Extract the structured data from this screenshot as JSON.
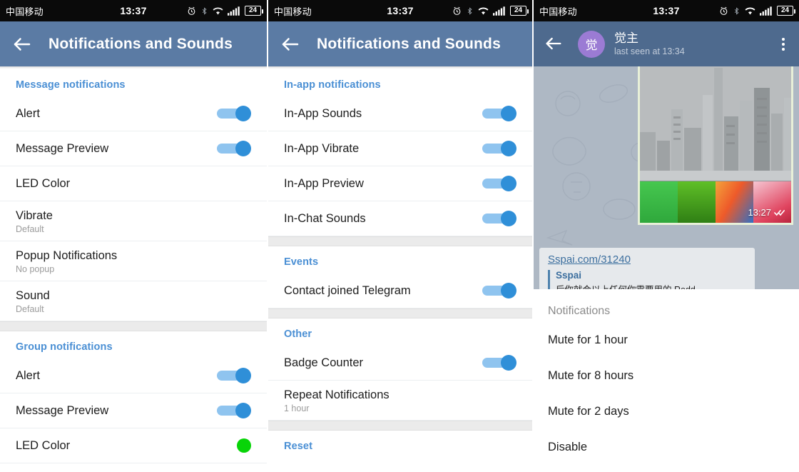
{
  "statusbar": {
    "carrier": "中国移动",
    "time": "13:37",
    "battery": "24",
    "icons": [
      "alarm-icon",
      "bluetooth-icon",
      "wifi-icon",
      "signal-icon",
      "battery-icon"
    ]
  },
  "colors": {
    "appbar": "#5b7ba4",
    "section_header": "#4a8fd4",
    "toggle_track": "#8fc4ef",
    "toggle_thumb": "#2f8fd8",
    "led_green": "#08d408",
    "avatar_purple": "#9b7bd4",
    "link_blue": "#3b6e9e",
    "chat_wallpaper": "#aeb8c4"
  },
  "panel1": {
    "title": "Notifications and Sounds",
    "back_label": "Back",
    "sections": [
      {
        "header": "Message notifications",
        "rows": [
          {
            "title": "Alert",
            "sub": "",
            "control": "toggle",
            "on": true
          },
          {
            "title": "Message Preview",
            "sub": "",
            "control": "toggle",
            "on": true
          },
          {
            "title": "LED Color",
            "sub": "",
            "control": "none",
            "on": false
          },
          {
            "title": "Vibrate",
            "sub": "Default",
            "control": "none",
            "on": false
          },
          {
            "title": "Popup Notifications",
            "sub": "No popup",
            "control": "none",
            "on": false
          },
          {
            "title": "Sound",
            "sub": "Default",
            "control": "none",
            "on": false
          }
        ]
      },
      {
        "header": "Group notifications",
        "rows": [
          {
            "title": "Alert",
            "sub": "",
            "control": "toggle",
            "on": true
          },
          {
            "title": "Message Preview",
            "sub": "",
            "control": "toggle",
            "on": true
          },
          {
            "title": "LED Color",
            "sub": "",
            "control": "led",
            "on": true
          }
        ]
      }
    ]
  },
  "panel2": {
    "title": "Notifications and Sounds",
    "back_label": "Back",
    "sections": [
      {
        "header": "In-app notifications",
        "rows": [
          {
            "title": "In-App Sounds",
            "sub": "",
            "control": "toggle",
            "on": true
          },
          {
            "title": "In-App Vibrate",
            "sub": "",
            "control": "toggle",
            "on": true
          },
          {
            "title": "In-App Preview",
            "sub": "",
            "control": "toggle",
            "on": true
          },
          {
            "title": "In-Chat Sounds",
            "sub": "",
            "control": "toggle",
            "on": true
          }
        ]
      },
      {
        "header": "Events",
        "rows": [
          {
            "title": "Contact joined Telegram",
            "sub": "",
            "control": "toggle",
            "on": true
          }
        ]
      },
      {
        "header": "Other",
        "rows": [
          {
            "title": "Badge Counter",
            "sub": "",
            "control": "toggle",
            "on": true
          },
          {
            "title": "Repeat Notifications",
            "sub": "1 hour",
            "control": "none",
            "on": false
          }
        ]
      },
      {
        "header": "Reset",
        "rows": []
      }
    ]
  },
  "panel3": {
    "back_label": "Back",
    "avatar_initial": "觉",
    "contact_name": "觉主",
    "contact_status": "last seen at 13:34",
    "menu_label": "More options",
    "message": {
      "time": "13:27",
      "read_state": "read",
      "strip_colors": [
        "#3fc14a",
        "#4aa81e",
        "#e8700f",
        "#e0445f"
      ]
    },
    "link_preview": {
      "url": "Sspai.com/31240",
      "site": "Sspai",
      "description": "后你就会以上任何你需要用的 Redd..."
    },
    "sheet": {
      "title": "Notifications",
      "items": [
        "Mute for 1 hour",
        "Mute for 8 hours",
        "Mute for 2 days",
        "Disable"
      ]
    }
  }
}
